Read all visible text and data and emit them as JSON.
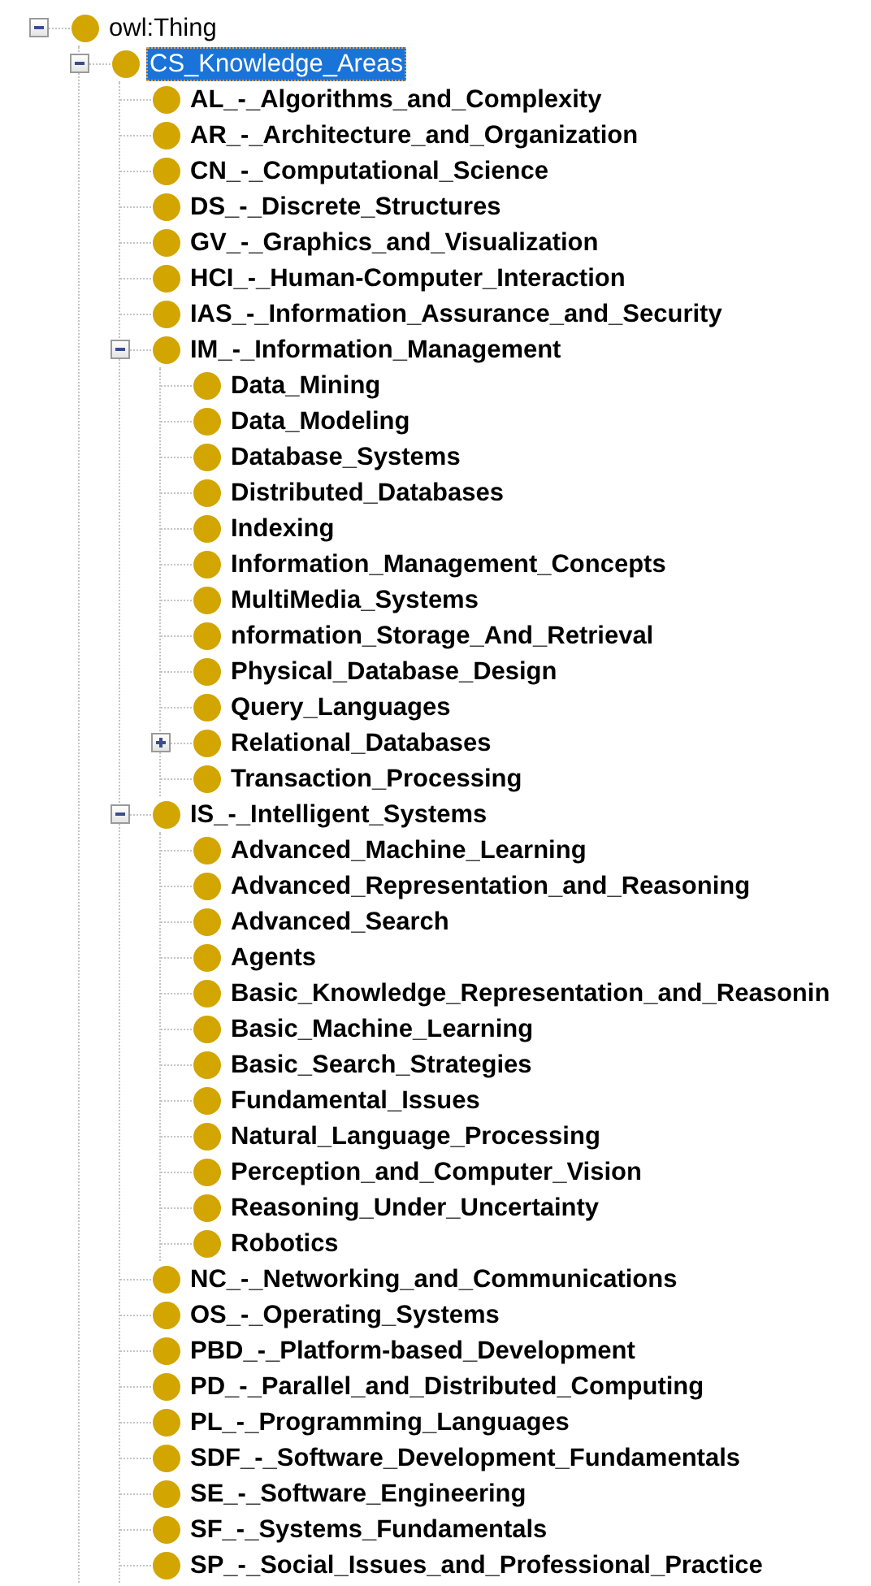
{
  "tree": [
    {
      "label": "owl:Thing",
      "bold": false,
      "selected": false,
      "expanded": true,
      "children": [
        {
          "label": "CS_Knowledge_Areas",
          "bold": false,
          "selected": true,
          "expanded": true,
          "children": [
            {
              "label": "AL_-_Algorithms_and_Complexity",
              "bold": true,
              "selected": false
            },
            {
              "label": "AR_-_Architecture_and_Organization",
              "bold": true,
              "selected": false
            },
            {
              "label": "CN_-_Computational_Science",
              "bold": true,
              "selected": false
            },
            {
              "label": "DS_-_Discrete_Structures",
              "bold": true,
              "selected": false
            },
            {
              "label": "GV_-_Graphics_and_Visualization",
              "bold": true,
              "selected": false
            },
            {
              "label": "HCI_-_Human-Computer_Interaction",
              "bold": true,
              "selected": false
            },
            {
              "label": "IAS_-_Information_Assurance_and_Security",
              "bold": true,
              "selected": false
            },
            {
              "label": "IM_-_Information_Management",
              "bold": true,
              "selected": false,
              "expanded": true,
              "children": [
                {
                  "label": "Data_Mining",
                  "bold": true,
                  "selected": false
                },
                {
                  "label": "Data_Modeling",
                  "bold": true,
                  "selected": false
                },
                {
                  "label": "Database_Systems",
                  "bold": true,
                  "selected": false
                },
                {
                  "label": "Distributed_Databases",
                  "bold": true,
                  "selected": false
                },
                {
                  "label": "Indexing",
                  "bold": true,
                  "selected": false
                },
                {
                  "label": "Information_Management_Concepts",
                  "bold": true,
                  "selected": false
                },
                {
                  "label": "MultiMedia_Systems",
                  "bold": true,
                  "selected": false
                },
                {
                  "label": "nformation_Storage_And_Retrieval",
                  "bold": true,
                  "selected": false
                },
                {
                  "label": "Physical_Database_Design",
                  "bold": true,
                  "selected": false
                },
                {
                  "label": "Query_Languages",
                  "bold": true,
                  "selected": false
                },
                {
                  "label": "Relational_Databases",
                  "bold": true,
                  "selected": false,
                  "expanded": false
                },
                {
                  "label": "Transaction_Processing",
                  "bold": true,
                  "selected": false
                }
              ]
            },
            {
              "label": "IS_-_Intelligent_Systems",
              "bold": true,
              "selected": false,
              "expanded": true,
              "children": [
                {
                  "label": "Advanced_Machine_Learning",
                  "bold": true,
                  "selected": false
                },
                {
                  "label": "Advanced_Representation_and_Reasoning",
                  "bold": true,
                  "selected": false
                },
                {
                  "label": "Advanced_Search",
                  "bold": true,
                  "selected": false
                },
                {
                  "label": "Agents",
                  "bold": true,
                  "selected": false
                },
                {
                  "label": "Basic_Knowledge_Representation_and_Reasonin",
                  "bold": true,
                  "selected": false
                },
                {
                  "label": "Basic_Machine_Learning",
                  "bold": true,
                  "selected": false
                },
                {
                  "label": "Basic_Search_Strategies",
                  "bold": true,
                  "selected": false
                },
                {
                  "label": "Fundamental_Issues",
                  "bold": true,
                  "selected": false
                },
                {
                  "label": "Natural_Language_Processing",
                  "bold": true,
                  "selected": false
                },
                {
                  "label": "Perception_and_Computer_Vision",
                  "bold": true,
                  "selected": false
                },
                {
                  "label": "Reasoning_Under_Uncertainty",
                  "bold": true,
                  "selected": false
                },
                {
                  "label": "Robotics",
                  "bold": true,
                  "selected": false
                }
              ]
            },
            {
              "label": "NC_-_Networking_and_Communications",
              "bold": true,
              "selected": false
            },
            {
              "label": "OS_-_Operating_Systems",
              "bold": true,
              "selected": false
            },
            {
              "label": "PBD_-_Platform-based_Development",
              "bold": true,
              "selected": false
            },
            {
              "label": "PD_-_Parallel_and_Distributed_Computing",
              "bold": true,
              "selected": false
            },
            {
              "label": "PL_-_Programming_Languages",
              "bold": true,
              "selected": false
            },
            {
              "label": "SDF_-_Software_Development_Fundamentals",
              "bold": true,
              "selected": false
            },
            {
              "label": "SE_-_Software_Engineering",
              "bold": true,
              "selected": false
            },
            {
              "label": "SF_-_Systems_Fundamentals",
              "bold": true,
              "selected": false
            },
            {
              "label": "SP_-_Social_Issues_and_Professional_Practice",
              "bold": true,
              "selected": false
            }
          ]
        }
      ]
    }
  ]
}
